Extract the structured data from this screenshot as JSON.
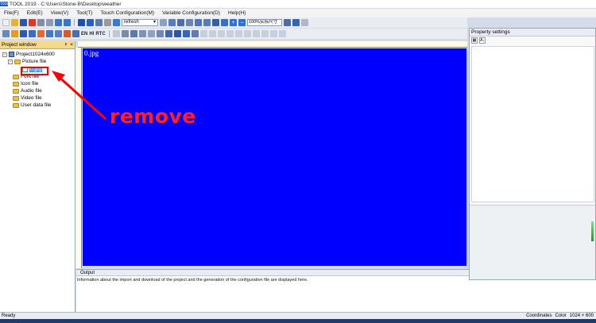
{
  "window": {
    "title": "TOOL 2019 - C:\\Users\\Stone-B\\Desktop\\weather",
    "app_icon_label": "TOOL"
  },
  "menu": [
    {
      "label": "File(F)"
    },
    {
      "label": "Edit(E)"
    },
    {
      "label": "View(V)"
    },
    {
      "label": "Tool(T)"
    },
    {
      "label": "Touch Configuration(M)"
    },
    {
      "label": "Variable Configuration(D)"
    },
    {
      "label": "Help(H)"
    }
  ],
  "toolbar": {
    "select_value": "refresh",
    "zoom_value": "100%实际尺寸",
    "text_en": "EN",
    "text_hi": "HI",
    "text_rtc": "RTC"
  },
  "project_window": {
    "title": "Project window",
    "pin": "ᵖ",
    "close": "×",
    "tree": {
      "root": "Project1024x600",
      "picture_folder": "Picture file",
      "selected_item": "0.jpg",
      "folders": [
        "Font file",
        "Icon file",
        "Audio file",
        "Video file",
        "User data file"
      ]
    }
  },
  "canvas": {
    "label": "0.jpg",
    "color": "#0000ff"
  },
  "output": {
    "tab": "Output",
    "message": "Information about the import and download of the project and the generation of the configuration file are displayed here."
  },
  "property_settings": {
    "title": "Property settings",
    "sort_label": "A↓"
  },
  "status": {
    "left": "Ready",
    "coordinates": "Coordinates",
    "color": "Color",
    "size": "1024 × 600"
  },
  "annotation": {
    "text": "remove",
    "color": "#ff0000"
  }
}
